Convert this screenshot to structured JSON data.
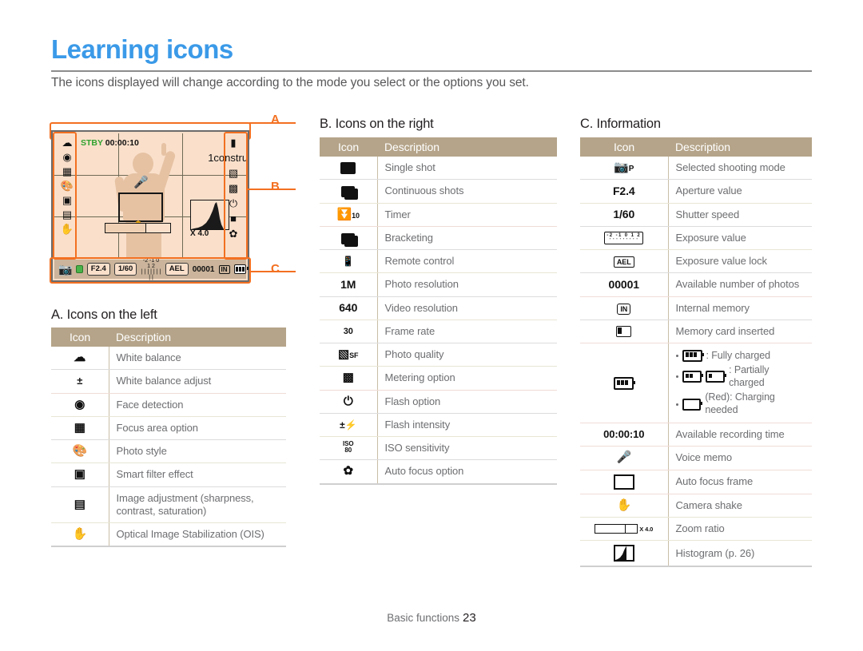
{
  "header": {
    "title": "Learning icons",
    "subtitle": "The icons displayed will change according to the mode you select or the options you set."
  },
  "lcd": {
    "status_label": "STBY",
    "recording_time": "00:00:10",
    "zoom_ratio": "X 4.0",
    "callouts": {
      "a": "A",
      "b": "B",
      "c": "C"
    },
    "bottom_bar": {
      "mode": "P",
      "aperture": "F2.4",
      "shutter": "1/60",
      "ev_scale_top": "-2 -1 0 1 2",
      "ev_scale_bottom": "| | | | | | | | |",
      "ael": "AEL",
      "shots": "00001",
      "memory": "IN"
    }
  },
  "section_a": {
    "heading": "A. Icons on the left",
    "columns": [
      "Icon",
      "Description"
    ],
    "rows": [
      {
        "icon": "white-balance-cloud-icon",
        "desc": "White balance"
      },
      {
        "icon": "white-balance-adjust-plusminus-icon",
        "desc": "White balance adjust"
      },
      {
        "icon": "face-detection-icon",
        "desc": "Face detection"
      },
      {
        "icon": "focus-area-option-icon",
        "desc": "Focus area option"
      },
      {
        "icon": "photo-style-palette-icon",
        "desc": "Photo style"
      },
      {
        "icon": "smart-filter-effect-icon",
        "desc": "Smart filter effect"
      },
      {
        "icon": "image-adjustment-icon",
        "desc": "Image adjustment (sharpness, contrast, saturation)"
      },
      {
        "icon": "ois-hand-icon",
        "desc": "Optical Image Stabilization (OIS)"
      }
    ]
  },
  "section_b": {
    "heading": "B. Icons on the right",
    "columns": [
      "Icon",
      "Description"
    ],
    "rows": [
      {
        "icon": "single-shot-icon",
        "desc": "Single shot"
      },
      {
        "icon": "continuous-shots-icon",
        "desc": "Continuous shots"
      },
      {
        "icon": "timer-icon",
        "icon_text": "10",
        "desc": "Timer"
      },
      {
        "icon": "bracketing-icon",
        "desc": "Bracketing"
      },
      {
        "icon": "remote-control-icon",
        "desc": "Remote control"
      },
      {
        "icon": "photo-resolution-icon",
        "icon_text": "1M",
        "desc": "Photo resolution"
      },
      {
        "icon": "video-resolution-icon",
        "icon_text": "640",
        "desc": "Video resolution"
      },
      {
        "icon": "frame-rate-icon",
        "icon_text": "30",
        "desc": "Frame rate"
      },
      {
        "icon": "photo-quality-icon",
        "icon_text": "SF",
        "desc": "Photo quality"
      },
      {
        "icon": "metering-option-icon",
        "desc": "Metering option"
      },
      {
        "icon": "flash-option-icon",
        "desc": "Flash option"
      },
      {
        "icon": "flash-intensity-icon",
        "desc": "Flash intensity"
      },
      {
        "icon": "iso-sensitivity-icon",
        "icon_text": "ISO 80",
        "desc": "ISO sensitivity"
      },
      {
        "icon": "auto-focus-macro-icon",
        "desc": "Auto focus option"
      }
    ]
  },
  "section_c": {
    "heading": "C. Information",
    "columns": [
      "Icon",
      "Description"
    ],
    "rows": [
      {
        "icon": "shooting-mode-camera-icon",
        "icon_text": "P",
        "desc": "Selected shooting mode"
      },
      {
        "icon": "aperture-value-text",
        "icon_text": "F2.4",
        "desc": "Aperture value"
      },
      {
        "icon": "shutter-speed-text",
        "icon_text": "1/60",
        "desc": "Shutter speed"
      },
      {
        "icon": "exposure-value-scale-icon",
        "icon_text": "-2 -1 0 1 2",
        "desc": "Exposure value"
      },
      {
        "icon": "exposure-lock-ael-icon",
        "icon_text": "AEL",
        "desc": "Exposure value lock"
      },
      {
        "icon": "available-photos-text",
        "icon_text": "00001",
        "desc": "Available number of photos"
      },
      {
        "icon": "internal-memory-icon",
        "icon_text": "IN",
        "desc": "Internal memory"
      },
      {
        "icon": "memory-card-icon",
        "desc": "Memory card inserted"
      },
      {
        "icon": "battery-icon",
        "desc": "",
        "bullets": [
          {
            "icon": "battery-full-icon",
            "text": ": Fully charged"
          },
          {
            "icon": "battery-partial-icon",
            "text": ": Partially charged"
          },
          {
            "icon": "battery-empty-icon",
            "text": "(Red): Charging needed"
          }
        ]
      },
      {
        "icon": "recording-time-text",
        "icon_text": "00:00:10",
        "desc": "Available recording time"
      },
      {
        "icon": "voice-memo-mic-icon",
        "desc": "Voice memo"
      },
      {
        "icon": "auto-focus-frame-icon",
        "desc": "Auto focus frame"
      },
      {
        "icon": "camera-shake-hand-icon",
        "desc": "Camera shake"
      },
      {
        "icon": "zoom-ratio-bar-icon",
        "icon_text": "X 4.0",
        "desc": "Zoom ratio"
      },
      {
        "icon": "histogram-icon",
        "desc": "Histogram (p. 26)"
      }
    ]
  },
  "footer": {
    "label": "Basic functions",
    "page": "23"
  },
  "colors": {
    "title_blue": "#3b9ae8",
    "callout_orange": "#f37021",
    "table_header_tan": "#b5a489",
    "body_gray": "#6d6e71",
    "lcd_bg": "#fae0cb",
    "lcd_bar": "#cbb49b",
    "stby_green": "#2fa22f"
  }
}
